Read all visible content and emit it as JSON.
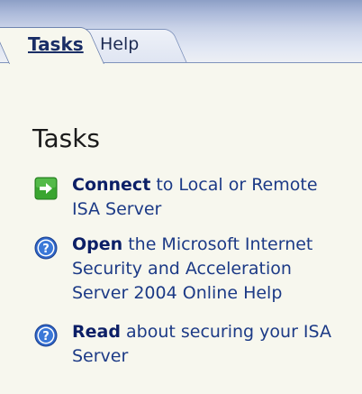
{
  "tabs": {
    "tasks_label": "Tasks",
    "help_label": "Help"
  },
  "section": {
    "heading": "Tasks"
  },
  "tasks": [
    {
      "icon": "arrow-right-icon",
      "verb": "Connect",
      "rest": " to Local or Remote ISA Server"
    },
    {
      "icon": "help-icon",
      "verb": "Open",
      "rest": " the Microsoft Internet Security and Acceleration Server 2004 Online Help"
    },
    {
      "icon": "help-icon",
      "verb": "Read",
      "rest": " about securing your ISA Server"
    }
  ],
  "colors": {
    "panel_background": "#f7f7ee",
    "link_text": "#0c1f66",
    "connect_icon": "#3aa530",
    "help_icon": "#2f66c8"
  }
}
